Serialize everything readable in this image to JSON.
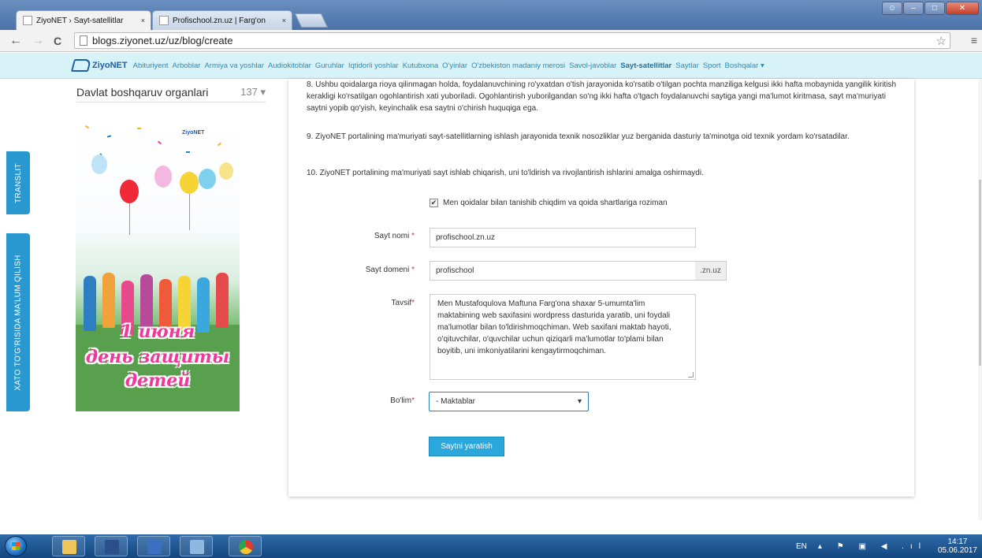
{
  "browser": {
    "tabs": [
      {
        "label": "ZiyoNET › Sayt-satellitlar",
        "close": "×",
        "active": true
      },
      {
        "label": "Profischool.zn.uz | Farg'on",
        "close": "×",
        "active": false
      }
    ],
    "url": "blogs.ziyonet.uz/uz/blog/create",
    "nav": {
      "back": "←",
      "forward": "→",
      "reload": "C",
      "star": "☆",
      "menu": "≡"
    }
  },
  "site_nav": {
    "logo": "ZiyoNET",
    "links": [
      "Abituriyent",
      "Arboblar",
      "Armiya va yoshlar",
      "Audiokitoblar",
      "Guruhlar",
      "Iqtidorli yoshlar",
      "Kutubxona",
      "O'yinlar",
      "O'zbekiston madaniy merosi",
      "Savol-javoblar",
      "Sayt-satellitlar",
      "Saytlar",
      "Sport",
      "Boshqalar ▾"
    ],
    "active_link": "Sayt-satellitlar"
  },
  "side_tabs": {
    "translit": "TRANSLIT",
    "report": "XATO TO'G'RISIDA MA'LUM QILISH"
  },
  "sidebar": {
    "category": "Davlat boshqaruv organlari",
    "count": "137 ▾"
  },
  "banner": {
    "logo": "ZiyoNET",
    "line1": "1 июня",
    "line2": "день защиты",
    "line3": "детей"
  },
  "rules": {
    "r8": "8. Ushbu qoidalarga rioya qilinmagan holda, foydalanuvchining ro'yxatdan o'tish jarayonida ko'rsatib o'tilgan pochta manziliga kelgusi ikki hafta mobaynida yangilik kiritish kerakligi ko'rsatilgan ogohlantirish xati yuboriladi. Ogohlantirish yuborilgandan so'ng ikki hafta o'tgach foydalanuvchi saytiga yangi ma'lumot kiritmasa, sayt ma'muriyati saytni yopib qo'yish, keyinchalik esa saytni o'chirish huquqiga ega.",
    "r9": "9. ZiyoNET portalining ma'muriyati sayt-satellitlarning ishlash jarayonida texnik nosozliklar yuz berganida dasturiy ta'minotga oid texnik yordam ko'rsatadilar.",
    "r10": "10. ZiyoNET portalining ma'muriyati sayt ishlab chiqarish, uni to'ldirish va rivojlantirish ishlarini amalga oshirmaydi."
  },
  "form": {
    "agree_label": "Men qoidalar bilan tanishib chiqdim va qoida shartlariga roziman",
    "agree_checked": "✔",
    "required_mark": "*",
    "site_name_label": "Sayt nomi",
    "site_name_value": "profischool.zn.uz",
    "domain_label": "Sayt domeni",
    "domain_value": "profischool",
    "domain_suffix": ".zn.uz",
    "description_label": "Tavsif",
    "description_value": "Men Mustafoqulova Maftuna Farg'ona shaxar 5-umumta'lim maktabining web saxifasini wordpress dasturida yaratib, uni foydali ma'lumotlar bilan to'ldirishmoqchiman. Web saxifani maktab hayoti, o'qituvchilar, o'quvchilar uchun qiziqarli ma'lumotlar to'plami bilan boyitib, uni imkoniyatilarini kengaytirmoqchiman.",
    "section_label": "Bo'lim",
    "section_value": "- Maktablar",
    "section_caret": "▾",
    "submit": "Saytni yaratish"
  },
  "taskbar": {
    "lang": "EN",
    "tray_icons": "▴ ⚑ ▣ ◀ .ıl",
    "time": "14:17",
    "date": "05.06.2017"
  }
}
